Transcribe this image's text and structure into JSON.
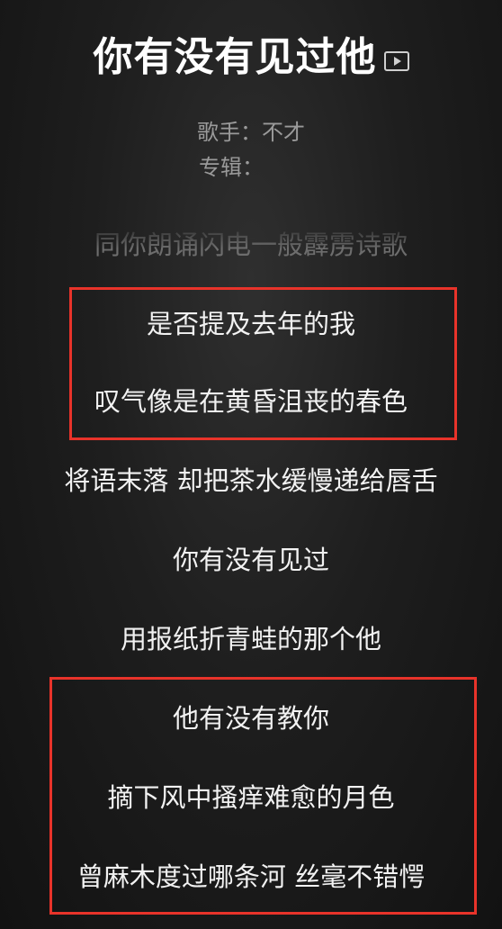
{
  "song": {
    "title": "你有没有见过他",
    "artist_line": "歌手：不才",
    "album_line": "专辑："
  },
  "icons": {
    "video": "video-play-icon"
  },
  "colors": {
    "highlight_border": "#e8332a"
  },
  "lyrics": [
    "同你朗诵闪电一般霹雳诗歌",
    "是否提及去年的我",
    "叹气像是在黄昏沮丧的春色",
    "将语末落 却把茶水缓慢递给唇舌",
    "你有没有见过",
    "用报纸折青蛙的那个他",
    "他有没有教你",
    "摘下风中搔痒难愈的月色",
    "曾麻木度过哪条河 丝毫不错愕"
  ]
}
